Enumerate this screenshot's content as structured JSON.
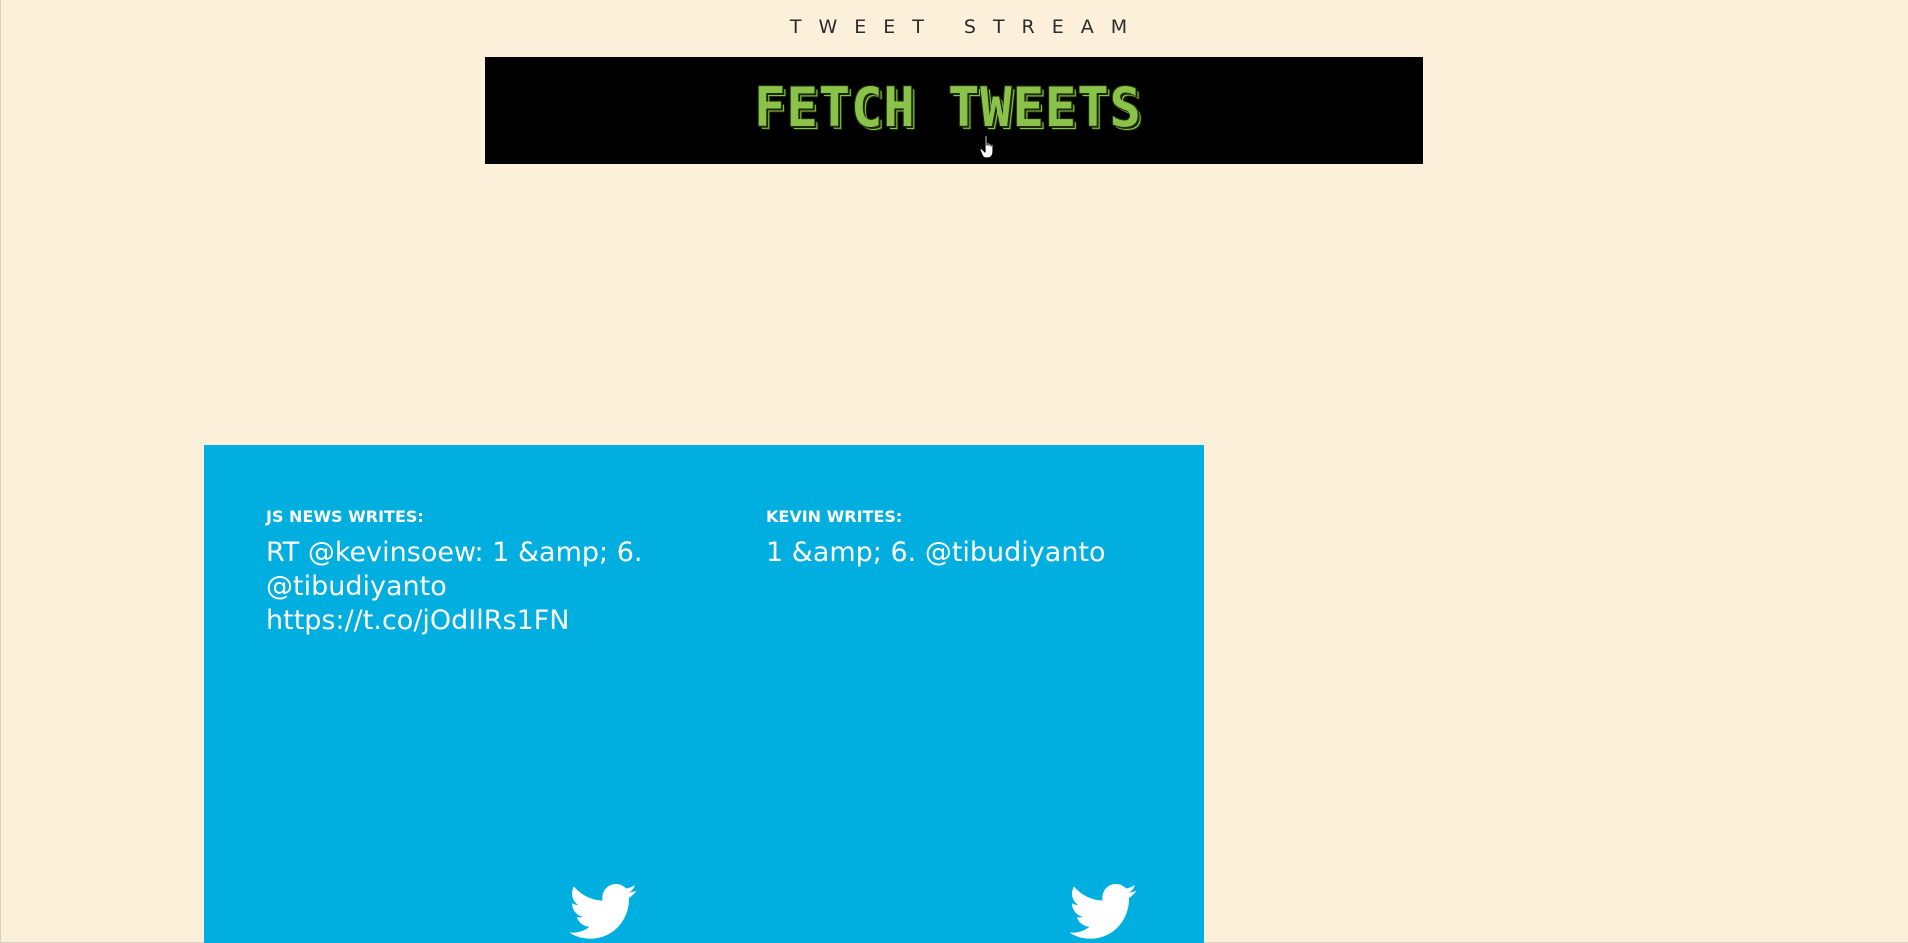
{
  "header": {
    "title": "TWEET STREAM"
  },
  "fetch_button": {
    "label": "FETCH TWEETS",
    "label_color": "#8bc34a",
    "background": "#000000"
  },
  "tweets": [
    {
      "author": "JS NEWS WRITES:",
      "text": "RT @kevinsoew: 1 &amp; 6. @tibudiyanto https://t.co/jOdIlRs1FN",
      "icon": "twitter-bird-icon"
    },
    {
      "author": "KEVIN WRITES:",
      "text": "1 &amp; 6. @tibudiyanto",
      "icon": "twitter-bird-icon"
    }
  ],
  "colors": {
    "page_background": "#fdf0da",
    "tweet_panel": "#00aee0",
    "tweet_text": "#ffffff"
  },
  "cursor": {
    "icon": "hand-pointer-icon"
  }
}
